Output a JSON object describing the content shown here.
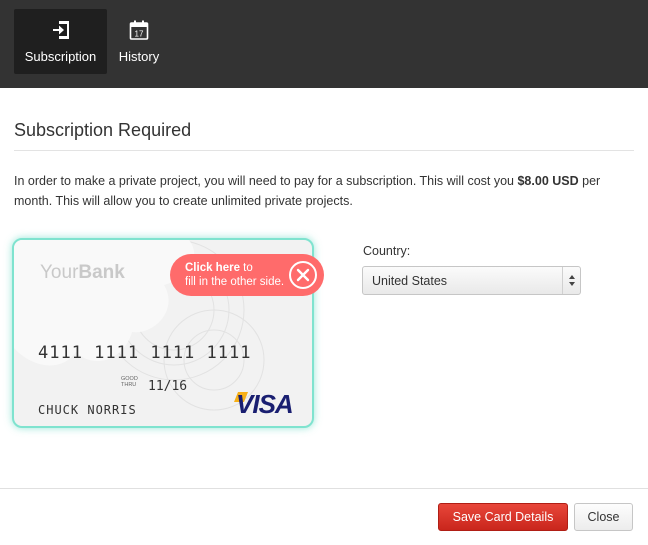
{
  "nav": {
    "tabs": [
      {
        "label": "Subscription",
        "icon": "sign-in-icon",
        "active": true
      },
      {
        "label": "History",
        "icon": "calendar-icon",
        "active": false
      }
    ],
    "calendar_day": "17"
  },
  "main": {
    "title": "Subscription Required",
    "description_pre": "In order to make a private project, you will need to pay for a subscription. This will cost you ",
    "description_price": "$8.00 USD",
    "description_post": " per month. This will allow you to create unlimited private projects."
  },
  "card": {
    "bank_light": "Your",
    "bank_bold": "Bank",
    "number": "4111 1111 1111 1111",
    "good_thru": "GOOD THRU",
    "expiry": "11/16",
    "holder": "CHUCK NORRIS",
    "brand": "VISA",
    "tip_bold": "Click here",
    "tip_rest": " to",
    "tip_line2": "fill in the other side.",
    "glow_color": "#7fe3cf",
    "tip_color": "#ff6b6b"
  },
  "country": {
    "label": "Country:",
    "selected": "United States"
  },
  "footer": {
    "save_label": "Save Card Details",
    "close_label": "Close",
    "save_color": "#d9342a"
  }
}
